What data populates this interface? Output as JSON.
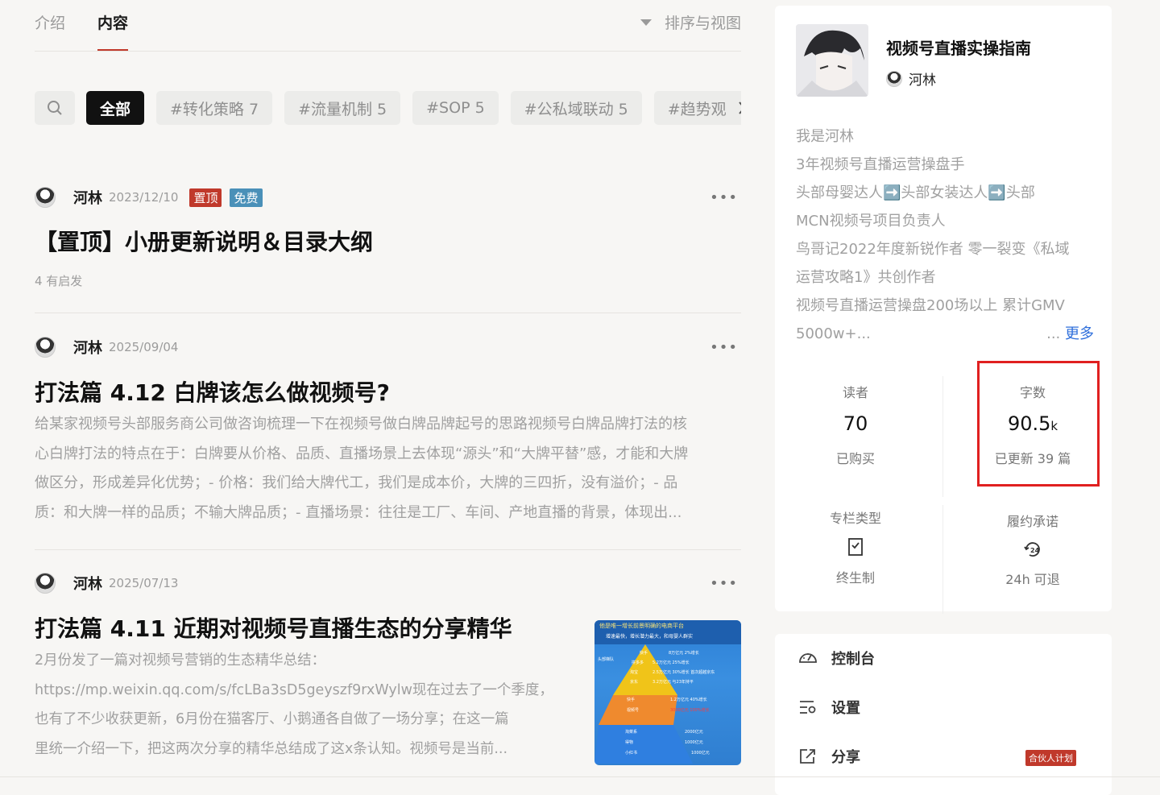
{
  "tabs": {
    "intro": "介绍",
    "content": "内容",
    "sort_view": "排序与视图"
  },
  "filters": [
    "全部",
    "#转化策略 7",
    "#流量机制 5",
    "#SOP 5",
    "#公私域联动 5",
    "#趋势观"
  ],
  "posts": [
    {
      "author": "河林",
      "date": "2023/12/10",
      "tags": [
        "置顶",
        "免费"
      ],
      "title": "【置顶】小册更新说明＆目录大纲",
      "sub": "4 有启发"
    },
    {
      "author": "河林",
      "date": "2025/09/04",
      "title": "打法篇 4.12 白牌该怎么做视频号?",
      "desc": [
        "给某家视频号头部服务商公司做咨询梳理一下在视频号做白牌品牌起号的思路视频号白牌品牌打法的核",
        "心白牌打法的特点在于：白牌要从价格、品质、直播场景上去体现“源头”和“大牌平替”感，才能和大牌",
        "做区分，形成差异化优势；- 价格：我们给大牌代工，我们是成本价，大牌的三四折，没有溢价；- 品",
        "质：和大牌一样的品质；不输大牌品质；- 直播场景：往往是工厂、车间、产地直播的背景，体现出..."
      ]
    },
    {
      "author": "河林",
      "date": "2025/07/13",
      "title": "打法篇 4.11 近期对视频号直播生态的分享精华",
      "desc": [
        "2月份发了一篇对视频号营销的生态精华总结：",
        "https://mp.weixin.qq.com/s/fcLBa3sD5geyszf9rxWylw现在过去了一个季度，",
        "也有了不少收获更新，6月份在猫客厅、小鹅通各自做了一场分享；在这一篇",
        "里统一介绍一下，把这两次分享的精华总结成了这x条认知。视频号是当前..."
      ]
    }
  ],
  "thumb": {
    "header": [
      "他是唯一增长前景明确的电商平台",
      "增速最快，增长潜力最大，和母婴人群实"
    ],
    "left_labels": [
      "头部梯队",
      "抖音",
      "快手",
      "视频号",
      "淘宝系",
      "得物",
      "小红书"
    ],
    "tier_labels": [
      "快手",
      "抖音",
      "拼多多",
      "淘宝",
      "京东",
      "快手",
      "视频号",
      "淘菜系",
      "得物",
      "小红书"
    ],
    "right_labels": [
      "8万亿元 2%增长",
      "5.2万亿元 25%增长",
      "2.5万亿元 30%增长 首次超越京东",
      "3.2万亿元 与23年持平",
      "1.2万亿元 40%增长",
      "3000亿元 100%增长",
      "2000亿元",
      "1000亿元",
      "1000亿元"
    ]
  },
  "column": {
    "title": "视频号直播实操指南",
    "author": "河林",
    "bio": [
      "我是河林",
      "3年视频号直播运营操盘手",
      "头部母婴达人➡️头部女装达人➡️头部",
      "MCN视频号项目负责人",
      "鸟哥记2022年度新锐作者 零一裂变《私域",
      "运营攻略1》共创作者",
      "视频号直播运营操盘200场以上 累计GMV"
    ],
    "bio_last": "5000w+...",
    "more_prefix": "... ",
    "more": "更多",
    "readers_label": "读者",
    "readers_value": "70",
    "readers_foot": "已购买",
    "words_label": "字数",
    "words_value": "90.5",
    "words_unit": "k",
    "words_foot": "已更新 39 篇",
    "type_label": "专栏类型",
    "type_value": "终生制",
    "promise_label": "履约承诺",
    "promise_value": "24h 可退"
  },
  "menu": {
    "console": "控制台",
    "settings": "设置",
    "share": "分享",
    "partner": "合伙人计划"
  },
  "colors": {
    "accent_red": "#c0392b",
    "link_blue": "#2f6fdb",
    "highlight": "#e02020"
  }
}
